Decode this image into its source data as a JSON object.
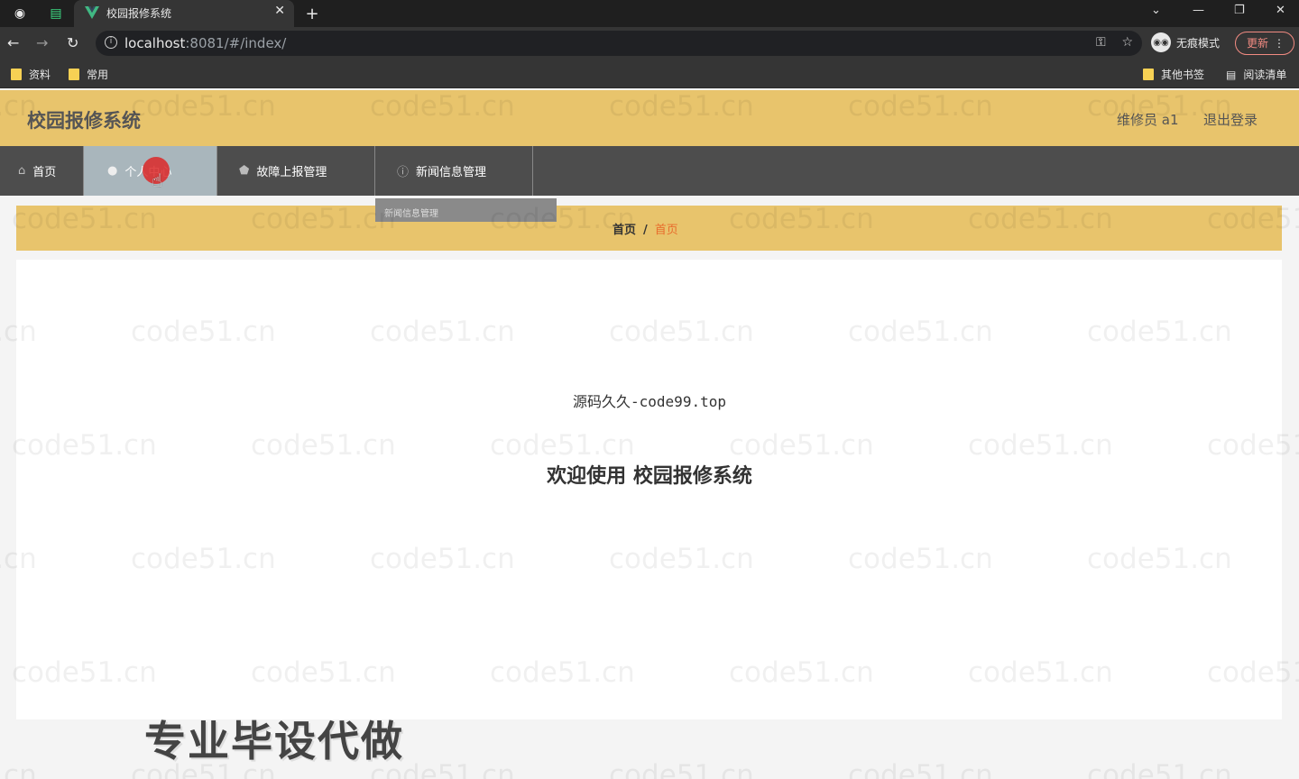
{
  "browser": {
    "tab_title": "校园报修系统",
    "url_host": "localhost",
    "url_rest": ":8081/#/index/",
    "incognito_label": "无痕模式",
    "update_label": "更新",
    "bookmarks": [
      "资料",
      "常用"
    ],
    "bookmarks_right": [
      "其他书签",
      "阅读清单"
    ]
  },
  "app": {
    "title": "校园报修系统",
    "user": "维修员 a1",
    "logout": "退出登录"
  },
  "menu": {
    "items": [
      {
        "label": "首页"
      },
      {
        "label": "个人中心"
      },
      {
        "label": "故障上报管理"
      },
      {
        "label": "新闻信息管理"
      }
    ],
    "dropdown_peek": "新闻信息管理"
  },
  "breadcrumb": {
    "home": "首页",
    "separator": "/",
    "current": "首页"
  },
  "main": {
    "source_text": "源码久久-code99.top",
    "welcome": "欢迎使用 校园报修系统"
  },
  "overlay": {
    "promo": "专业毕设代做",
    "watermark": "code51.cn"
  }
}
